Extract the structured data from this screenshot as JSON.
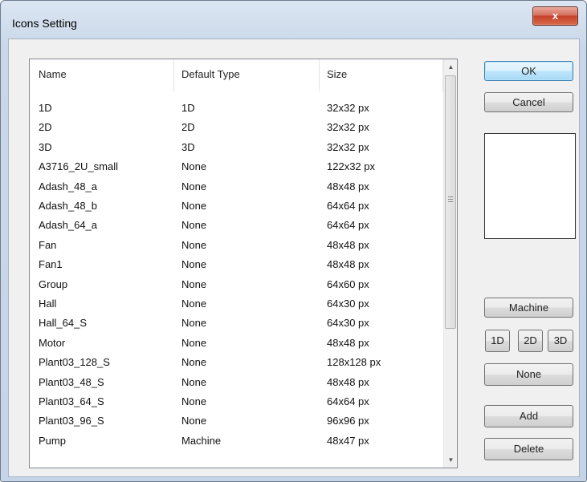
{
  "window": {
    "title": "Icons Setting",
    "close_label": "x"
  },
  "table": {
    "headers": [
      "Name",
      "Default Type",
      "Size"
    ],
    "rows": [
      [
        "1D",
        "1D",
        "32x32 px"
      ],
      [
        "2D",
        "2D",
        "32x32 px"
      ],
      [
        "3D",
        "3D",
        "32x32 px"
      ],
      [
        "A3716_2U_small",
        "None",
        "122x32 px"
      ],
      [
        "Adash_48_a",
        "None",
        "48x48 px"
      ],
      [
        "Adash_48_b",
        "None",
        "64x64 px"
      ],
      [
        "Adash_64_a",
        "None",
        "64x64 px"
      ],
      [
        "Fan",
        "None",
        "48x48 px"
      ],
      [
        "Fan1",
        "None",
        "48x48 px"
      ],
      [
        "Group",
        "None",
        "64x60 px"
      ],
      [
        "Hall",
        "None",
        "64x30 px"
      ],
      [
        "Hall_64_S",
        "None",
        "64x30 px"
      ],
      [
        "Motor",
        "None",
        "48x48 px"
      ],
      [
        "Plant03_128_S",
        "None",
        "128x128 px"
      ],
      [
        "Plant03_48_S",
        "None",
        "48x48 px"
      ],
      [
        "Plant03_64_S",
        "None",
        "64x64 px"
      ],
      [
        "Plant03_96_S",
        "None",
        "96x96 px"
      ],
      [
        "Pump",
        "Machine",
        "48x47 px"
      ]
    ]
  },
  "buttons": {
    "ok": "OK",
    "cancel": "Cancel",
    "machine": "Machine",
    "type_1d": "1D",
    "type_2d": "2D",
    "type_3d": "3D",
    "none": "None",
    "add": "Add",
    "delete": "Delete"
  }
}
